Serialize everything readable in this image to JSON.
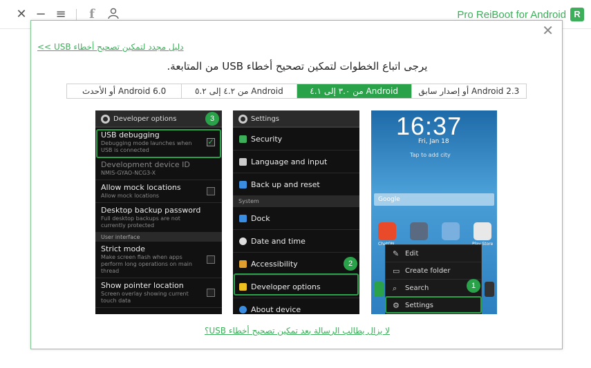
{
  "app": {
    "title": "Pro ReiBoot for Android",
    "logo_letter": "R",
    "brand_color": "#3dae5a",
    "window_buttons": {
      "close": "✕",
      "minimize": "−",
      "menu": "≡",
      "facebook": "f",
      "user": "user-icon"
    }
  },
  "dialog": {
    "close": "✕",
    "guide_link": "دليل مجدد لتمكين تصحيح أخطاء USB >>",
    "instruction": "يرجى اتباع الخطوات لتمكين تصحيح أخطاء USB من المتابعة.",
    "tabs": [
      {
        "label": "Android 6.0 أو الأحدث",
        "active": false
      },
      {
        "label": "Android من ٤.٢ إلى ٥.٢",
        "active": false
      },
      {
        "label": "Android من ٣.٠ إلى ٤.١",
        "active": true
      },
      {
        "label": "Android 2.3 أو إصدار سابق",
        "active": false
      }
    ],
    "still_link": "لا يزال يطالب الرسالة بعد تمكين تصحيح أخطاء USB؟"
  },
  "developer_options": {
    "header": "Developer options",
    "step": "3",
    "rows": [
      {
        "title": "USB debugging",
        "sub": "Debugging mode launches when USB is connected",
        "checked": true
      },
      {
        "title": "Development device ID",
        "sub": "NMIS-GYAO-NCG3-X",
        "muted": true
      },
      {
        "title": "Allow mock locations",
        "sub": "Allow mock locations"
      },
      {
        "title": "Desktop backup password",
        "sub": "Full desktop backups are not currently protected"
      }
    ],
    "section": "User interface",
    "rows2": [
      {
        "title": "Strict mode",
        "sub": "Make screen flash when apps perform long operations on main thread"
      },
      {
        "title": "Show pointer location",
        "sub": "Screen overlay showing current touch data"
      }
    ]
  },
  "settings": {
    "header": "Settings",
    "step": "2",
    "items": [
      "Security",
      "Language and input",
      "Back up and reset"
    ],
    "section": "System",
    "items2": [
      "Dock",
      "Date and time",
      "Accessibility",
      "Developer options",
      "About device"
    ],
    "icon_colors": [
      "#3dae5a",
      "#cccccc",
      "#3a8de0",
      "#3a8de0",
      "#dddddd",
      "#e0a030",
      "#f0c020",
      "#3a8de0"
    ]
  },
  "home": {
    "time": "16:37",
    "date": "Fri, Jan 18",
    "tap_city": "Tap to add city",
    "google": "Google",
    "step": "1",
    "apps": [
      "ChatON",
      "Camera",
      "Gallery",
      "Play Store"
    ],
    "menu": [
      {
        "label": "Edit",
        "icon": "edit-icon"
      },
      {
        "label": "Create folder",
        "icon": "folder-icon"
      },
      {
        "label": "Search",
        "icon": "search-icon"
      },
      {
        "label": "Settings",
        "icon": "gear-icon"
      }
    ],
    "dock_left": "Phone",
    "dock_right": "Apps"
  }
}
